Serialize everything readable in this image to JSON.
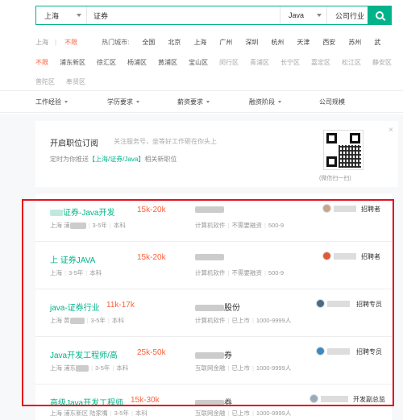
{
  "search": {
    "city": "上海",
    "keyword": "证券",
    "language": "Java",
    "industry": "公司行业"
  },
  "city_row": {
    "label": "上海",
    "separator": "|",
    "current": "不限",
    "hot_label": "热门城市:",
    "cities": [
      "全国",
      "北京",
      "上海",
      "广州",
      "深圳",
      "杭州",
      "天津",
      "西安",
      "苏州",
      "武"
    ]
  },
  "districts": {
    "current": "不限",
    "row1": [
      "浦东新区",
      "徐汇区",
      "杨浦区",
      "黄浦区",
      "宝山区",
      "闵行区",
      "青浦区",
      "长宁区",
      "嘉定区",
      "松江区",
      "静安区"
    ],
    "row2": [
      "普陀区",
      "奉贤区"
    ]
  },
  "filters": [
    "工作经验",
    "学历要求",
    "薪资要求",
    "融资阶段",
    "公司规模"
  ],
  "subscription": {
    "title": "开启职位订阅",
    "tip": "关注服务号，坐等好工作砸在你头上",
    "line_prefix": "定时为你推送",
    "line_tag": "【上海/证券/Java】",
    "line_suffix": "相关新职位",
    "scan_hint": "(微信扫一扫)",
    "close": "×"
  },
  "jobs": [
    {
      "title": "证券-Java开发",
      "salary": "15k-20k",
      "meta": [
        "上海 浦",
        "3-5年",
        "本科"
      ],
      "company": "",
      "cmeta": [
        "计算机软件",
        "不需要融资",
        "500-9"
      ],
      "role": "招聘者"
    },
    {
      "title": "上 证券JAVA",
      "salary": "15k-20k",
      "meta": [
        "上海",
        "3-5年",
        "本科"
      ],
      "company": "",
      "cmeta": [
        "计算机软件",
        "不需要融资",
        "500-9"
      ],
      "role": "招聘者"
    },
    {
      "title": "java-证券行业",
      "salary": "11k-17k",
      "meta": [
        "上海 黄",
        "3-5年",
        "本科"
      ],
      "company": "股份",
      "cmeta": [
        "计算机软件",
        "已上市",
        "1000-9999人"
      ],
      "role": "招聘专员"
    },
    {
      "title": "Java开发工程师/高",
      "salary": "25k-50k",
      "meta": [
        "上海 浦东",
        "3-5年",
        "本科"
      ],
      "company": "券",
      "cmeta": [
        "互联网金融",
        "已上市",
        "1000-9999人"
      ],
      "role": "招聘专员"
    },
    {
      "title": "高级Java开发工程师",
      "salary": "15k-30k",
      "meta": [
        "上海 浦东新区 陆家嘴",
        "3-5年",
        "本科"
      ],
      "company": "券",
      "cmeta": [
        "互联网金融",
        "已上市",
        "1000-9999人"
      ],
      "role": "开发副总监"
    }
  ],
  "colors": {
    "accent": "#00b38a",
    "salary": "#fd5f39",
    "highlight": "#e4101e"
  }
}
